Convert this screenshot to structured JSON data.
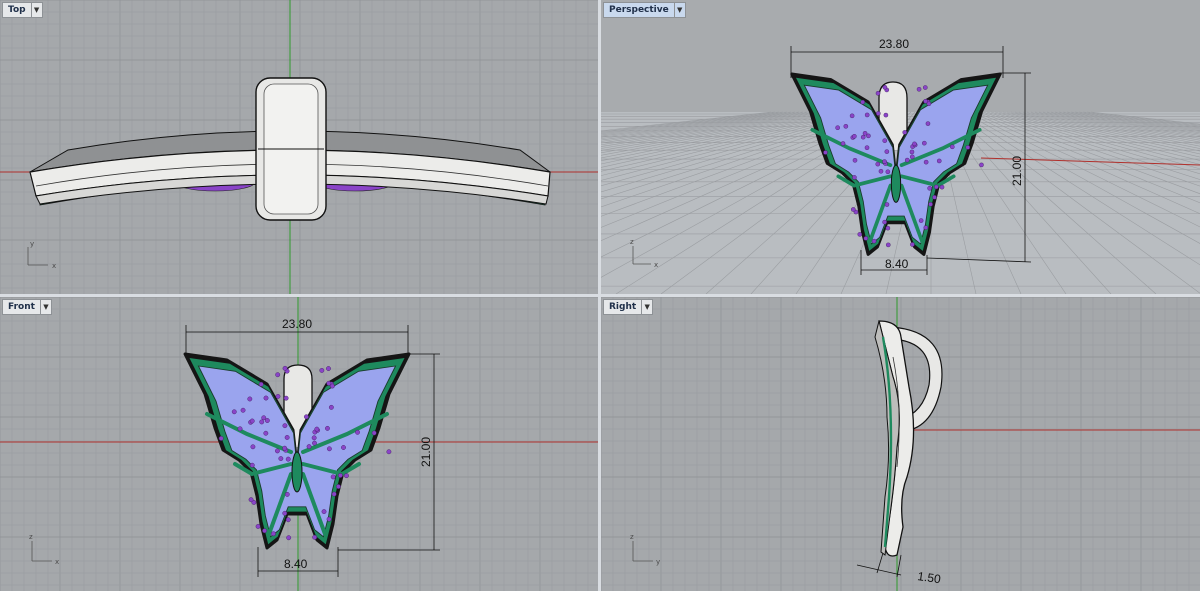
{
  "viewports": {
    "top": {
      "label": "Top",
      "axis_x": "x",
      "axis_y": "y"
    },
    "perspective": {
      "label": "Perspective",
      "axis_x": "x",
      "axis_y": "z",
      "dim_width": "23.80",
      "dim_height": "21.00",
      "dim_base": "8.40"
    },
    "front": {
      "label": "Front",
      "axis_x": "x",
      "axis_y": "z",
      "dim_width": "23.80",
      "dim_height": "21.00",
      "dim_base": "8.40"
    },
    "right": {
      "label": "Right",
      "axis_x": "y",
      "axis_y": "z",
      "dim_thickness": "1.50"
    }
  },
  "colors": {
    "viewport_bg": "#a5a8ab",
    "grid_minor": "#9b9ea2",
    "grid_major": "#8e9195",
    "x_axis": "#b0302c",
    "y_axis": "#2e9a2e",
    "gem_fill": "#9aa4ee",
    "stone_purple": "#8a44c8",
    "stone_green": "#1e8a5e",
    "metal": "#e8e8e6",
    "outline": "#151515"
  },
  "icons": {
    "dropdown": "chevron-down-icon",
    "axis_widget": "axis-triad-icon"
  }
}
